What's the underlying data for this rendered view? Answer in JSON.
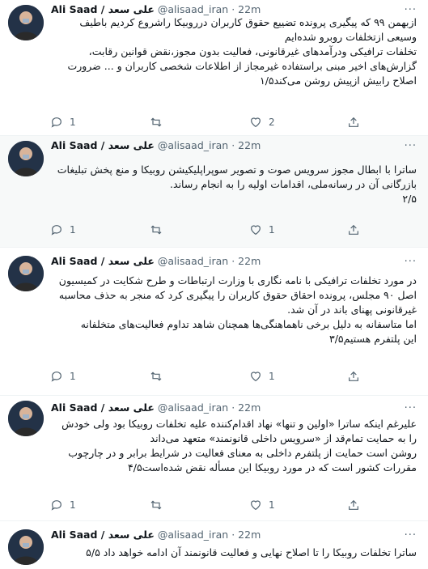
{
  "tweets": [
    {
      "name": "Ali Saad / علی سعد",
      "handle": "@alisaad_iran",
      "sep": "·",
      "time": "22m",
      "more": "...",
      "lines": [
        "ازبهمن ۹۹ که پیگیری پرونده تضییع حقوق کاربران درروبیکا راشروع کردیم باطیف",
        "وسیعی ازتخلفات روبرو شده‌ایم",
        "تخلفات ترافیکی ودرآمدهای غیرقانونی، فعالیت بدون مجوز،نقض قوانین رقابت،",
        "گزارش‌های اخیر مبنی براستفاده غیرمجاز از اطلاعات شخصی کاربران و ... ضرورت",
        "اصلاح رابیش ازپیش روشن می‌کند۱/۵"
      ],
      "reply_count": "1",
      "retweet_count": "",
      "like_count": "2"
    },
    {
      "name": "Ali Saad / علی سعد",
      "handle": "@alisaad_iran",
      "sep": "·",
      "time": "22m",
      "more": "...",
      "lines": [
        "ساترا با ابطال مجوز سرویس صوت و تصویر سوپراپلیکیشن روبیکا و منع پخش تبلیغات",
        "بازرگانی آن در رسانه‌ملی، اقدامات اولیه را به انجام رساند.",
        "۲/۵"
      ],
      "reply_count": "1",
      "retweet_count": "",
      "like_count": "1"
    },
    {
      "name": "Ali Saad / علی سعد",
      "handle": "@alisaad_iran",
      "sep": "·",
      "time": "22m",
      "more": "...",
      "lines": [
        "در مورد تخلفات ترافیکی با نامه نگاری با وزارت ارتباطات و طرح شکایت در کمیسیون",
        "اصل ۹۰ مجلس، پرونده احقاق حقوق کاربران را پیگیری کرد که منجر به حذف محاسبه",
        "غیرقانونی پهنای باند در آن شد.",
        "اما متاسفانه به دلیل برخی ناهماهنگی‌ها همچنان شاهد تداوم فعالیت‌های متخلفانه",
        "این پلتفرم هستیم۳/۵"
      ],
      "reply_count": "1",
      "retweet_count": "",
      "like_count": "1"
    },
    {
      "name": "Ali Saad / علی سعد",
      "handle": "@alisaad_iran",
      "sep": "·",
      "time": "22m",
      "more": "...",
      "lines": [
        "علیرغم اینکه ساترا «اولین و تنها» نهاد اقدام‌کننده علیه تخلفات روبیکا بود ولی خودش",
        "را به حمایت تمام‌قد از «سرویس داخلی قانونمند» متعهد می‌داند",
        "روشن است حمایت از پلتفرم داخلی به معنای فعالیت در شرایط برابر و در چارچوب",
        "مقررات کشور است که در مورد روبیکا این مسأله نقض شده‌است۴/۵"
      ],
      "reply_count": "1",
      "retweet_count": "",
      "like_count": "1"
    },
    {
      "name": "Ali Saad / علی سعد",
      "handle": "@alisaad_iran",
      "sep": "·",
      "time": "22m",
      "more": "...",
      "lines": [
        "ساترا تخلفات روبیکا را تا اصلاح نهایی و فعالیت قانونمند آن ادامه خواهد داد ۵/۵"
      ]
    }
  ]
}
